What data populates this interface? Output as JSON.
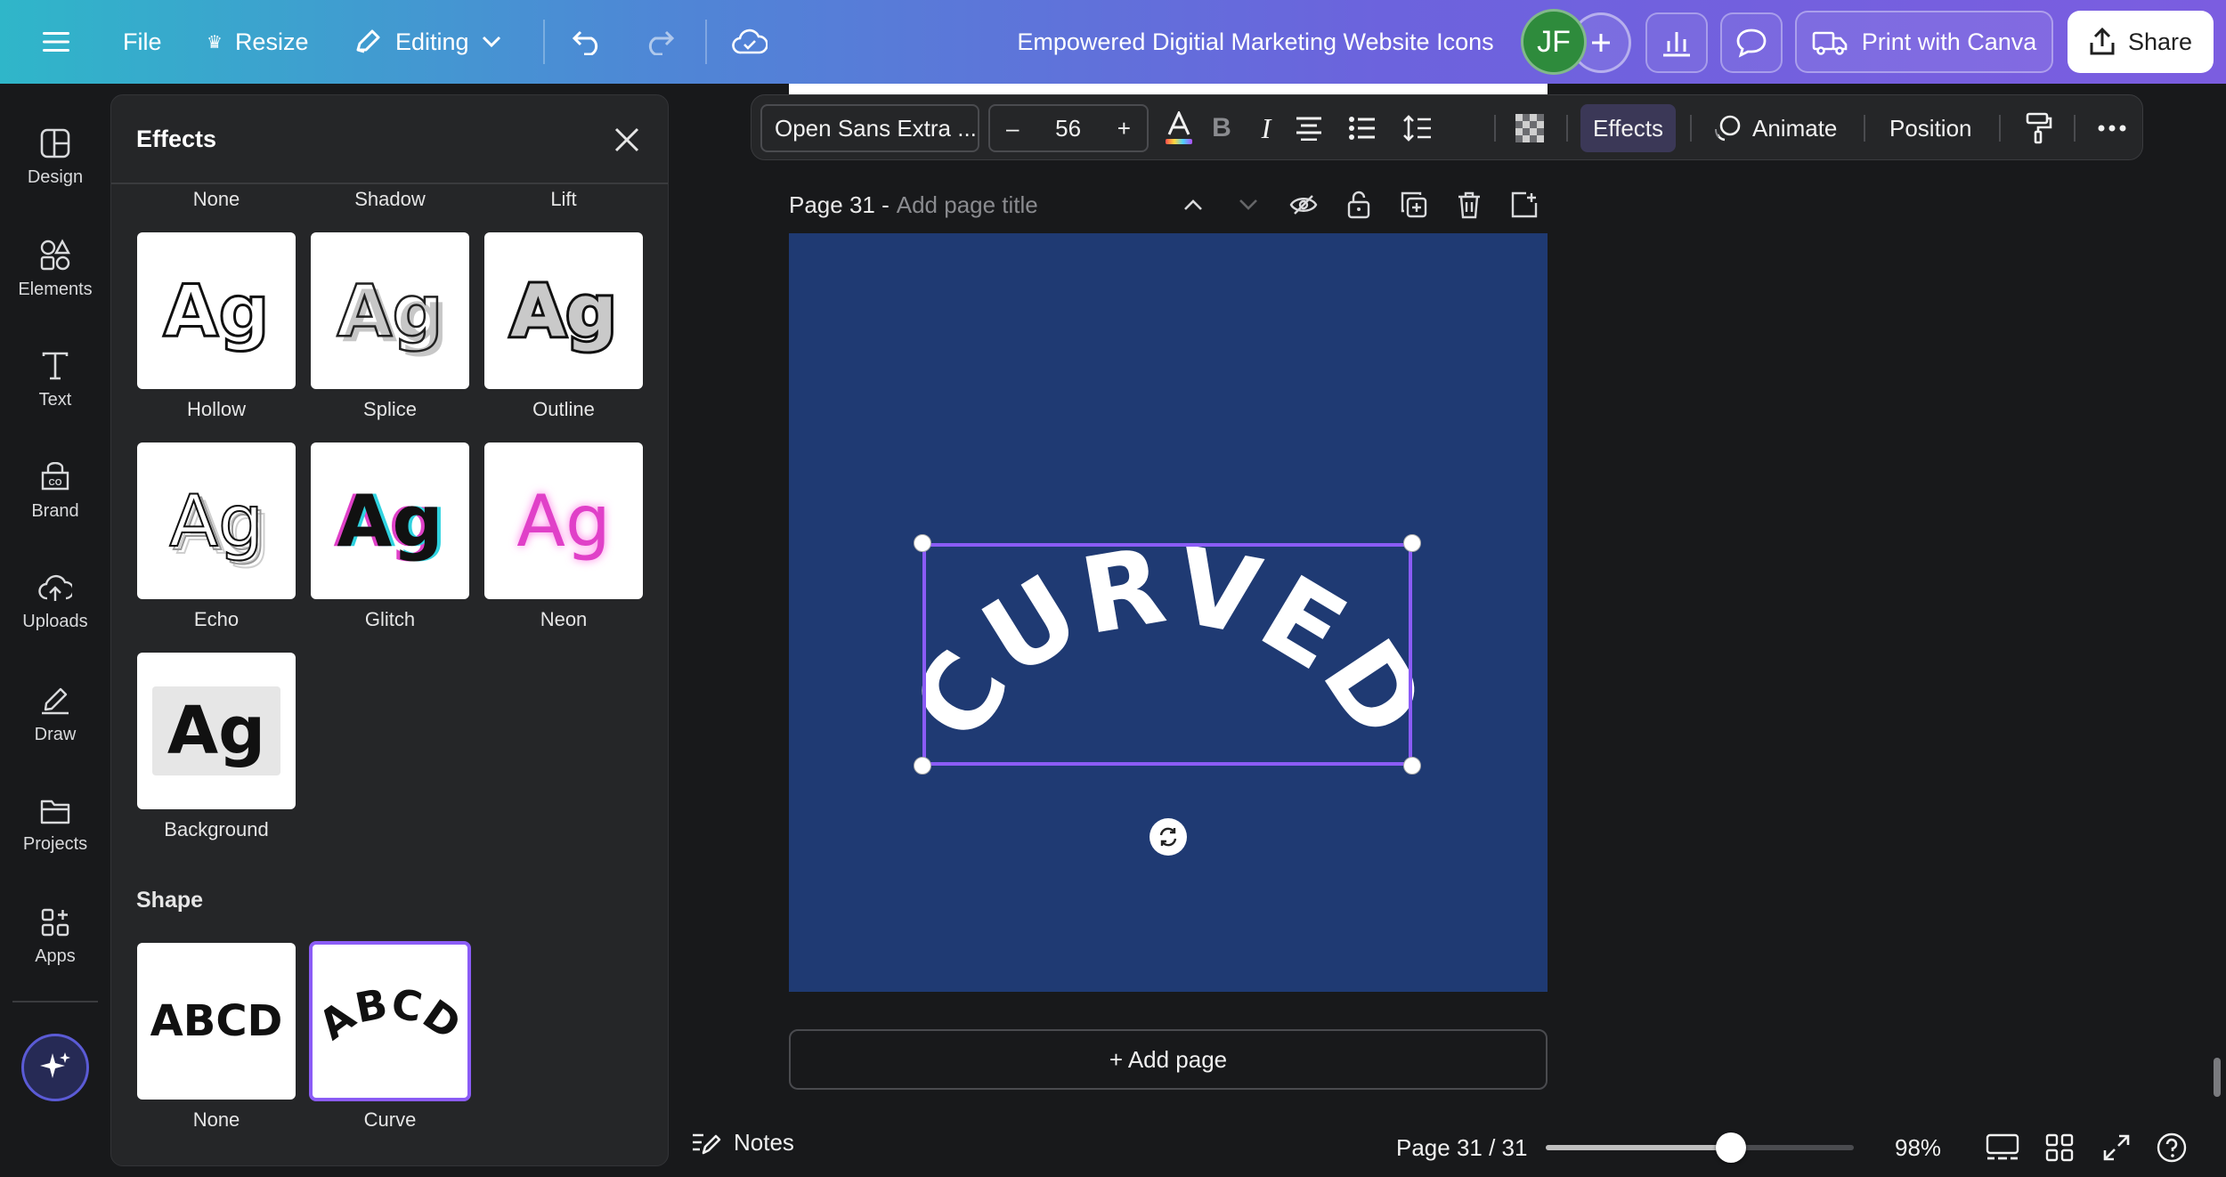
{
  "topbar": {
    "file_label": "File",
    "resize_label": "Resize",
    "editing_label": "Editing",
    "doc_title": "Empowered Digitial Marketing Website Icons",
    "avatar_initials": "JF",
    "print_label": "Print with Canva",
    "share_label": "Share"
  },
  "rail": {
    "items": [
      {
        "label": "Design",
        "icon": "design-icon"
      },
      {
        "label": "Elements",
        "icon": "elements-icon"
      },
      {
        "label": "Text",
        "icon": "text-icon"
      },
      {
        "label": "Brand",
        "icon": "brand-icon"
      },
      {
        "label": "Uploads",
        "icon": "uploads-icon"
      },
      {
        "label": "Draw",
        "icon": "draw-icon"
      },
      {
        "label": "Projects",
        "icon": "projects-icon"
      },
      {
        "label": "Apps",
        "icon": "apps-icon"
      }
    ]
  },
  "panel": {
    "title": "Effects",
    "top_labels": [
      "None",
      "Shadow",
      "Lift"
    ],
    "styles": [
      {
        "label": "Hollow",
        "sample": "Ag"
      },
      {
        "label": "Splice",
        "sample": "Ag"
      },
      {
        "label": "Outline",
        "sample": "Ag"
      },
      {
        "label": "Echo",
        "sample": "Ag"
      },
      {
        "label": "Glitch",
        "sample": "Ag"
      },
      {
        "label": "Neon",
        "sample": "Ag"
      },
      {
        "label": "Background",
        "sample": "Ag"
      }
    ],
    "shape_title": "Shape",
    "shapes": [
      {
        "label": "None",
        "sample": "ABCD",
        "selected": false
      },
      {
        "label": "Curve",
        "sample": "ABCD",
        "selected": true
      }
    ]
  },
  "toolbar": {
    "font": "Open Sans Extra ...",
    "minus": "–",
    "font_size": "56",
    "plus": "+",
    "effects_label": "Effects",
    "animate_label": "Animate",
    "position_label": "Position"
  },
  "canvas": {
    "page_label": "Page 31 -",
    "page_title_placeholder": "Add page title",
    "curved_text": "CURVED",
    "add_page_label": "+ Add page",
    "page_bg": "#1f3a73"
  },
  "bottom": {
    "notes_label": "Notes",
    "page_count": "Page 31 / 31",
    "zoom": "98%",
    "zoom_slider_fraction": 0.6
  },
  "colors": {
    "accent": "#8b5cf6",
    "neon": "#e040c8",
    "glitch_cyan": "#2fd3e0"
  }
}
